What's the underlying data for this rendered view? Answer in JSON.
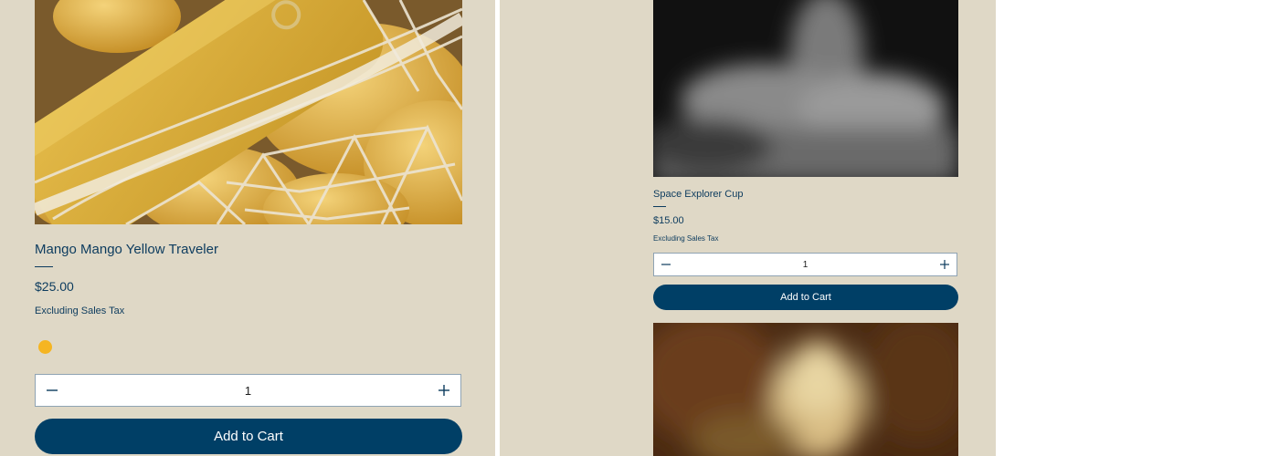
{
  "products": [
    {
      "title": "Mango Mango Yellow Traveler",
      "price": "$25.00",
      "tax_note": "Excluding Sales Tax",
      "swatch_color": "#f5b522",
      "quantity": "1",
      "cart_label": "Add to Cart",
      "decrease_icon": "minus-icon",
      "increase_icon": "plus-icon"
    },
    {
      "title": "Space Explorer Cup",
      "price": "$15.00",
      "tax_note": "Excluding Sales Tax",
      "quantity": "1",
      "cart_label": "Add to Cart",
      "decrease_icon": "minus-icon",
      "increase_icon": "plus-icon"
    }
  ],
  "colors": {
    "panel_bg": "#dfd8c6",
    "brand_navy": "#003f66",
    "text_navy": "#0c3b5e"
  }
}
